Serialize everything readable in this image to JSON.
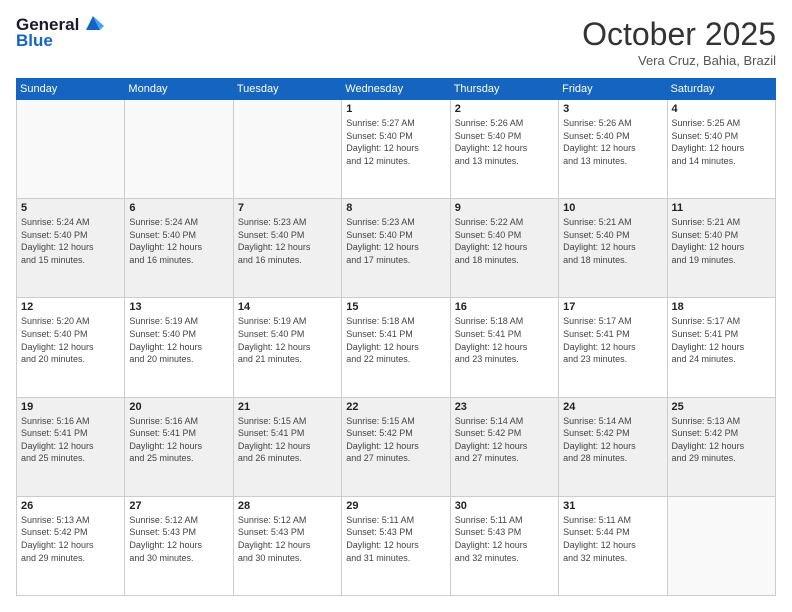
{
  "logo": {
    "line1": "General",
    "line2": "Blue"
  },
  "header": {
    "month": "October 2025",
    "location": "Vera Cruz, Bahia, Brazil"
  },
  "weekdays": [
    "Sunday",
    "Monday",
    "Tuesday",
    "Wednesday",
    "Thursday",
    "Friday",
    "Saturday"
  ],
  "weeks": [
    [
      {
        "day": "",
        "info": ""
      },
      {
        "day": "",
        "info": ""
      },
      {
        "day": "",
        "info": ""
      },
      {
        "day": "1",
        "info": "Sunrise: 5:27 AM\nSunset: 5:40 PM\nDaylight: 12 hours\nand 12 minutes."
      },
      {
        "day": "2",
        "info": "Sunrise: 5:26 AM\nSunset: 5:40 PM\nDaylight: 12 hours\nand 13 minutes."
      },
      {
        "day": "3",
        "info": "Sunrise: 5:26 AM\nSunset: 5:40 PM\nDaylight: 12 hours\nand 13 minutes."
      },
      {
        "day": "4",
        "info": "Sunrise: 5:25 AM\nSunset: 5:40 PM\nDaylight: 12 hours\nand 14 minutes."
      }
    ],
    [
      {
        "day": "5",
        "info": "Sunrise: 5:24 AM\nSunset: 5:40 PM\nDaylight: 12 hours\nand 15 minutes."
      },
      {
        "day": "6",
        "info": "Sunrise: 5:24 AM\nSunset: 5:40 PM\nDaylight: 12 hours\nand 16 minutes."
      },
      {
        "day": "7",
        "info": "Sunrise: 5:23 AM\nSunset: 5:40 PM\nDaylight: 12 hours\nand 16 minutes."
      },
      {
        "day": "8",
        "info": "Sunrise: 5:23 AM\nSunset: 5:40 PM\nDaylight: 12 hours\nand 17 minutes."
      },
      {
        "day": "9",
        "info": "Sunrise: 5:22 AM\nSunset: 5:40 PM\nDaylight: 12 hours\nand 18 minutes."
      },
      {
        "day": "10",
        "info": "Sunrise: 5:21 AM\nSunset: 5:40 PM\nDaylight: 12 hours\nand 18 minutes."
      },
      {
        "day": "11",
        "info": "Sunrise: 5:21 AM\nSunset: 5:40 PM\nDaylight: 12 hours\nand 19 minutes."
      }
    ],
    [
      {
        "day": "12",
        "info": "Sunrise: 5:20 AM\nSunset: 5:40 PM\nDaylight: 12 hours\nand 20 minutes."
      },
      {
        "day": "13",
        "info": "Sunrise: 5:19 AM\nSunset: 5:40 PM\nDaylight: 12 hours\nand 20 minutes."
      },
      {
        "day": "14",
        "info": "Sunrise: 5:19 AM\nSunset: 5:40 PM\nDaylight: 12 hours\nand 21 minutes."
      },
      {
        "day": "15",
        "info": "Sunrise: 5:18 AM\nSunset: 5:41 PM\nDaylight: 12 hours\nand 22 minutes."
      },
      {
        "day": "16",
        "info": "Sunrise: 5:18 AM\nSunset: 5:41 PM\nDaylight: 12 hours\nand 23 minutes."
      },
      {
        "day": "17",
        "info": "Sunrise: 5:17 AM\nSunset: 5:41 PM\nDaylight: 12 hours\nand 23 minutes."
      },
      {
        "day": "18",
        "info": "Sunrise: 5:17 AM\nSunset: 5:41 PM\nDaylight: 12 hours\nand 24 minutes."
      }
    ],
    [
      {
        "day": "19",
        "info": "Sunrise: 5:16 AM\nSunset: 5:41 PM\nDaylight: 12 hours\nand 25 minutes."
      },
      {
        "day": "20",
        "info": "Sunrise: 5:16 AM\nSunset: 5:41 PM\nDaylight: 12 hours\nand 25 minutes."
      },
      {
        "day": "21",
        "info": "Sunrise: 5:15 AM\nSunset: 5:41 PM\nDaylight: 12 hours\nand 26 minutes."
      },
      {
        "day": "22",
        "info": "Sunrise: 5:15 AM\nSunset: 5:42 PM\nDaylight: 12 hours\nand 27 minutes."
      },
      {
        "day": "23",
        "info": "Sunrise: 5:14 AM\nSunset: 5:42 PM\nDaylight: 12 hours\nand 27 minutes."
      },
      {
        "day": "24",
        "info": "Sunrise: 5:14 AM\nSunset: 5:42 PM\nDaylight: 12 hours\nand 28 minutes."
      },
      {
        "day": "25",
        "info": "Sunrise: 5:13 AM\nSunset: 5:42 PM\nDaylight: 12 hours\nand 29 minutes."
      }
    ],
    [
      {
        "day": "26",
        "info": "Sunrise: 5:13 AM\nSunset: 5:42 PM\nDaylight: 12 hours\nand 29 minutes."
      },
      {
        "day": "27",
        "info": "Sunrise: 5:12 AM\nSunset: 5:43 PM\nDaylight: 12 hours\nand 30 minutes."
      },
      {
        "day": "28",
        "info": "Sunrise: 5:12 AM\nSunset: 5:43 PM\nDaylight: 12 hours\nand 30 minutes."
      },
      {
        "day": "29",
        "info": "Sunrise: 5:11 AM\nSunset: 5:43 PM\nDaylight: 12 hours\nand 31 minutes."
      },
      {
        "day": "30",
        "info": "Sunrise: 5:11 AM\nSunset: 5:43 PM\nDaylight: 12 hours\nand 32 minutes."
      },
      {
        "day": "31",
        "info": "Sunrise: 5:11 AM\nSunset: 5:44 PM\nDaylight: 12 hours\nand 32 minutes."
      },
      {
        "day": "",
        "info": ""
      }
    ]
  ]
}
